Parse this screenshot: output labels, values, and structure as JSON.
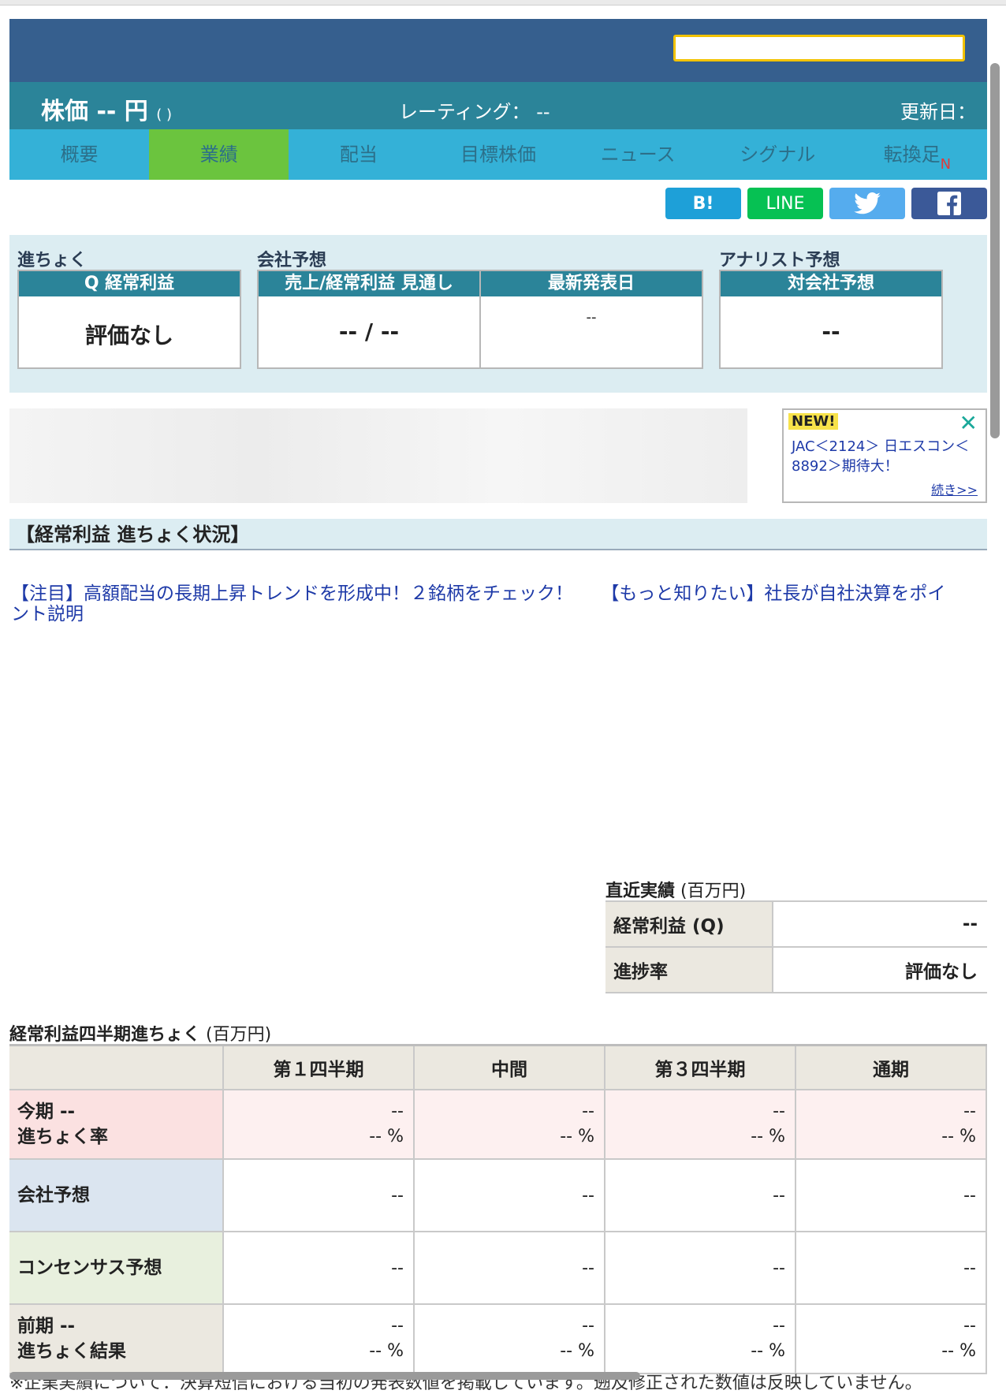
{
  "header": {
    "search_placeholder": "",
    "price_text": "株価 -- 円",
    "price_suffix": "( )",
    "rating": "レーティング： --",
    "update": "更新日："
  },
  "tabs": [
    {
      "label": "概要",
      "active": false
    },
    {
      "label": "業績",
      "active": true
    },
    {
      "label": "配当",
      "active": false
    },
    {
      "label": "目標株価",
      "active": false
    },
    {
      "label": "ニュース",
      "active": false
    },
    {
      "label": "シグナル",
      "active": false
    },
    {
      "label": "転換足",
      "active": false,
      "badge": "N"
    }
  ],
  "share": {
    "hatena": "B!",
    "line": "LINE",
    "twitter_icon": "twitter-bird-icon",
    "facebook": "f"
  },
  "summary": {
    "progress_label": "進ちょく",
    "company_label": "会社予想",
    "analyst_label": "アナリスト予想",
    "progress_header": "Q 経常利益",
    "progress_value": "評価なし",
    "outlook_header": "売上/経常利益 見通し",
    "outlook_value": "-- / --",
    "latest_header": "最新発表日",
    "latest_value": "--",
    "vs_header": "対会社予想",
    "vs_value": "--"
  },
  "news_box": {
    "badge": "NEW!",
    "text": "JAC＜2124＞ 日エスコン＜8892＞期待大！",
    "more": "続き>>"
  },
  "section_title": "【経常利益 進ちょく状況】",
  "links": [
    "【注目】高額配当の長期上昇トレンドを形成中！２銘柄をチェック！",
    "【もっと知りたい】社長が自社決算をポイント説明"
  ],
  "recent": {
    "title": "直近実績",
    "unit": "(百万円)",
    "rows": [
      {
        "label": "経常利益 (Q)",
        "value": "--"
      },
      {
        "label": "進捗率",
        "value": "評価なし"
      }
    ]
  },
  "quarterly": {
    "title": "経常利益四半期進ちょく",
    "unit": "(百万円)",
    "columns": [
      "第１四半期",
      "中間",
      "第３四半期",
      "通期"
    ],
    "rows": [
      {
        "label1": "今期 --",
        "label2": "進ちょく率",
        "values": [
          [
            "--",
            "-- %"
          ],
          [
            "--",
            "-- %"
          ],
          [
            "--",
            "-- %"
          ],
          [
            "--",
            "-- %"
          ]
        ]
      },
      {
        "label1": "会社予想",
        "label2": "",
        "values": [
          [
            "--"
          ],
          [
            "--"
          ],
          [
            "--"
          ],
          [
            "--"
          ]
        ]
      },
      {
        "label1": "コンセンサス予想",
        "label2": "",
        "values": [
          [
            "--"
          ],
          [
            "--"
          ],
          [
            "--"
          ],
          [
            "--"
          ]
        ]
      },
      {
        "label1": "前期 --",
        "label2": "進ちょく結果",
        "values": [
          [
            "--",
            "-- %"
          ],
          [
            "--",
            "-- %"
          ],
          [
            "--",
            "-- %"
          ],
          [
            "--",
            "-- %"
          ]
        ]
      }
    ]
  },
  "note": "※企業実績について：決算短信における当初の発表数値を掲載しています。遡及修正された数値は反映していません。"
}
